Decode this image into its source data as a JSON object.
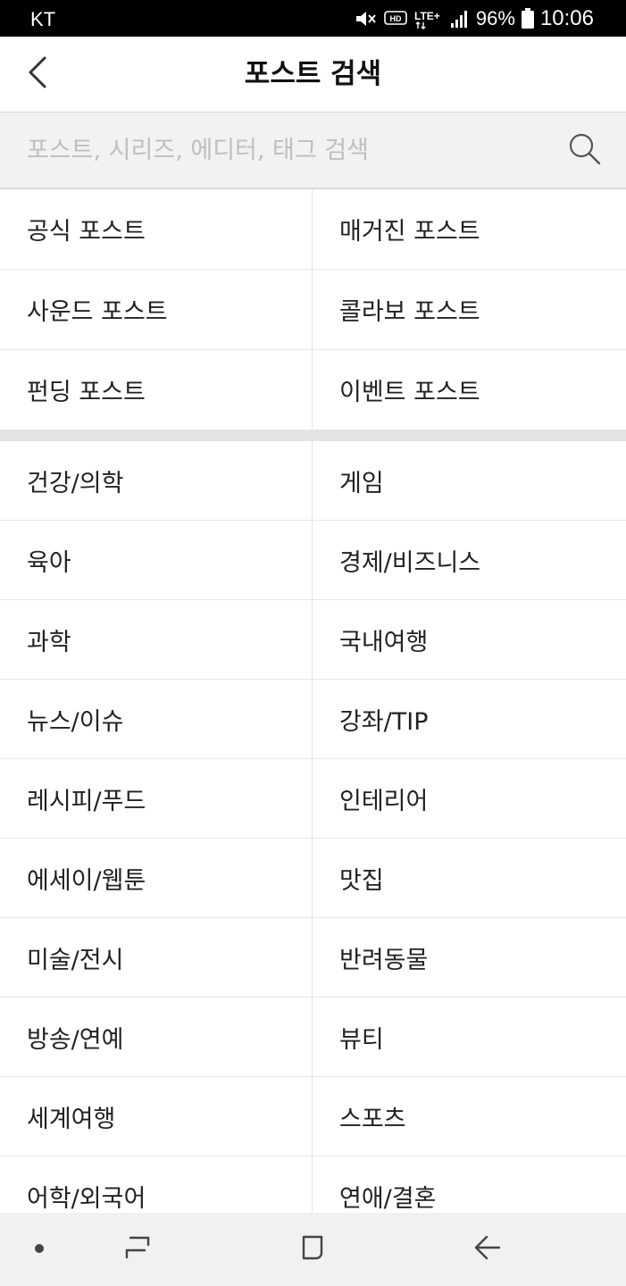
{
  "status_bar": {
    "carrier": "KT",
    "network": "LTE+",
    "battery": "96%",
    "time": "10:06",
    "icons": [
      "mute-icon",
      "hd-icon",
      "lte-icon",
      "signal-icon",
      "battery-icon"
    ]
  },
  "header": {
    "title": "포스트 검색",
    "back_icon": "chevron-left-icon"
  },
  "search": {
    "placeholder": "포스트, 시리즈, 에디터, 태그 검색",
    "value": "",
    "icon": "search-icon"
  },
  "post_types": [
    "공식 포스트",
    "매거진 포스트",
    "사운드 포스트",
    "콜라보 포스트",
    "펀딩 포스트",
    "이벤트 포스트"
  ],
  "categories": [
    "건강/의학",
    "게임",
    "육아",
    "경제/비즈니스",
    "과학",
    "국내여행",
    "뉴스/이슈",
    "강좌/TIP",
    "레시피/푸드",
    "인테리어",
    "에세이/웹툰",
    "맛집",
    "미술/전시",
    "반려동물",
    "방송/연예",
    "뷰티",
    "세계여행",
    "스포츠",
    "어학/외국어",
    "연애/결혼"
  ],
  "nav_bar": {
    "icons": [
      "dot-icon",
      "recent-apps-icon",
      "home-icon",
      "back-arrow-icon"
    ]
  },
  "colors": {
    "status_bar_bg": "#000000",
    "search_bg": "#f2f2f2",
    "divider": "#e3e3e3",
    "nav_bg": "#f1f1f1"
  }
}
